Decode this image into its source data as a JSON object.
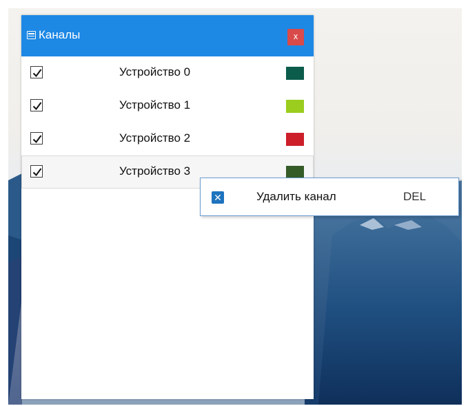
{
  "window": {
    "title": "Каналы",
    "close_label": "x"
  },
  "channels": [
    {
      "label": "Устройство 0",
      "checked": true,
      "color": "#0b5c4b"
    },
    {
      "label": "Устройство 1",
      "checked": true,
      "color": "#9acd1e"
    },
    {
      "label": "Устройство 2",
      "checked": true,
      "color": "#cc1f2a"
    },
    {
      "label": "Устройство 3",
      "checked": true,
      "color": "#355c27"
    }
  ],
  "context_menu": {
    "items": [
      {
        "label": "Удалить канал",
        "shortcut": "DEL",
        "icon": "delete-icon"
      }
    ]
  },
  "colors": {
    "titlebar": "#1e88e5",
    "close_button": "#d94a4a",
    "menu_icon": "#1e73be"
  }
}
